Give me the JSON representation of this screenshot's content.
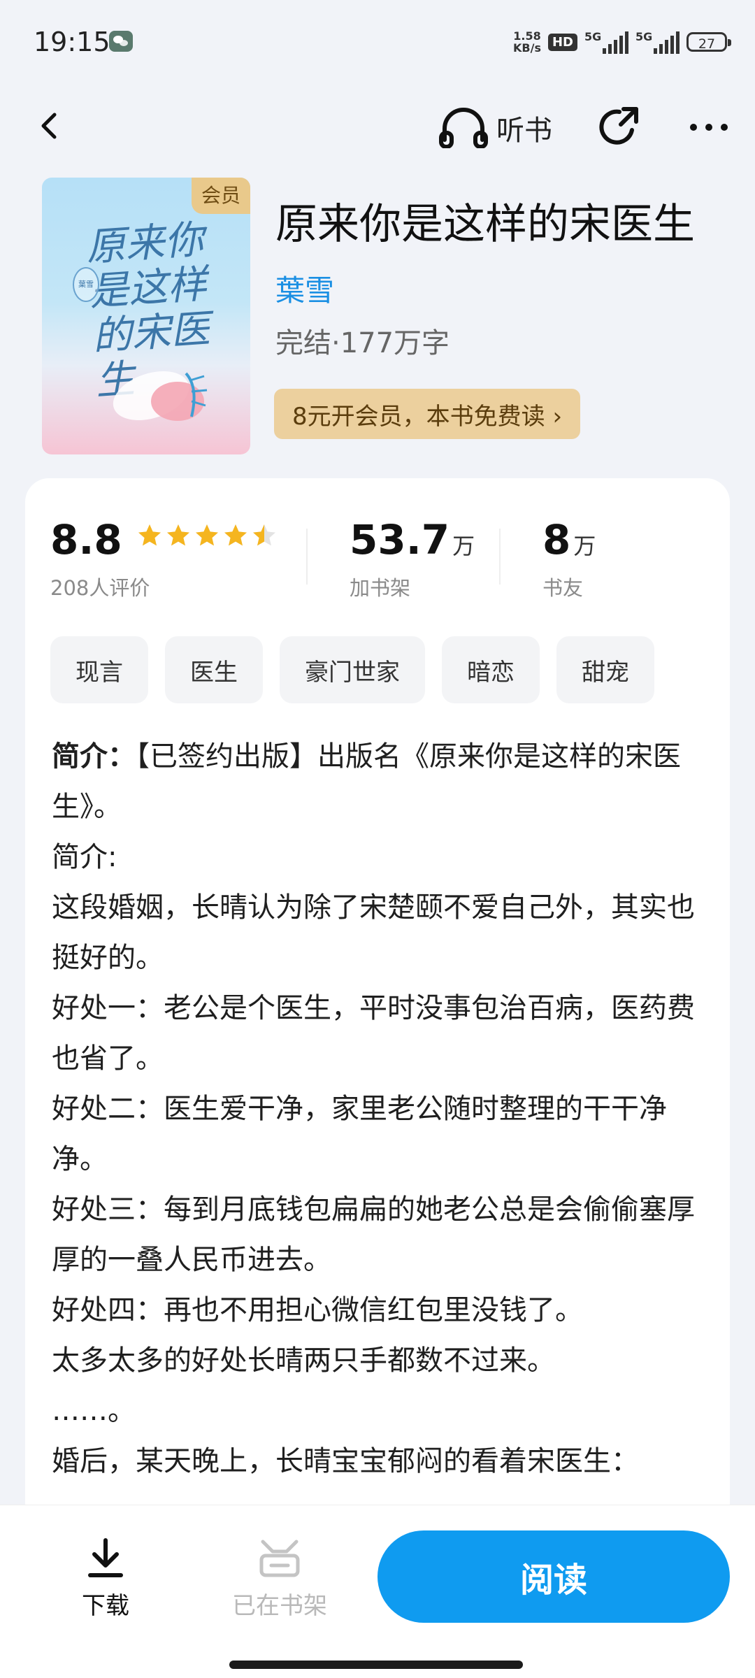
{
  "status_bar": {
    "time": "19:15",
    "net_speed": "1.58",
    "net_unit": "KB/s",
    "hd_label": "HD",
    "signal1_label": "5G",
    "signal2_label": "5G",
    "battery": "27"
  },
  "nav": {
    "listen_label": "听书"
  },
  "book": {
    "cover_title": "原来你是这样的宋医生",
    "cover_author": "葉雪",
    "vip_badge": "会员",
    "title": "原来你是这样的宋医生",
    "author": "葉雪",
    "meta": "完结·177万字",
    "vip_offer": "8元开会员，本书免费读 ›"
  },
  "stats": {
    "rating": "8.8",
    "rating_stars": 4.5,
    "rating_label": "208人评价",
    "shelf_num": "53.7",
    "shelf_unit": "万",
    "shelf_label": "加书架",
    "friends_num": "8",
    "friends_unit": "万",
    "friends_label": "书友"
  },
  "tags": [
    "现言",
    "医生",
    "豪门世家",
    "暗恋",
    "甜宠"
  ],
  "intro": {
    "head_label": "简介：",
    "head_text": "【已签约出版】出版名《原来你是这样的宋医生》。",
    "lines": [
      "简介:",
      "这段婚姻，长晴认为除了宋楚颐不爱自己外，其实也挺好的。",
      "好处一：老公是个医生，平时没事包治百病，医药费也省了。",
      "好处二：医生爱干净，家里老公随时整理的干干净净。",
      "好处三：每到月底钱包扁扁的她老公总是会偷偷塞厚厚的一叠人民币进去。",
      "好处四：再也不用担心微信红包里没钱了。",
      "太多太多的好处长晴两只手都数不过来。",
      "……。",
      "婚后，某天晚上，长晴宝宝郁闷的看着宋医生："
    ]
  },
  "bottom": {
    "download_label": "下载",
    "shelf_label": "已在书架",
    "read_label": "阅读"
  },
  "colors": {
    "accent": "#0f9bf0",
    "author_blue": "#1a8fe3",
    "vip_gold": "#ecd09e",
    "star": "#f5b51f"
  }
}
